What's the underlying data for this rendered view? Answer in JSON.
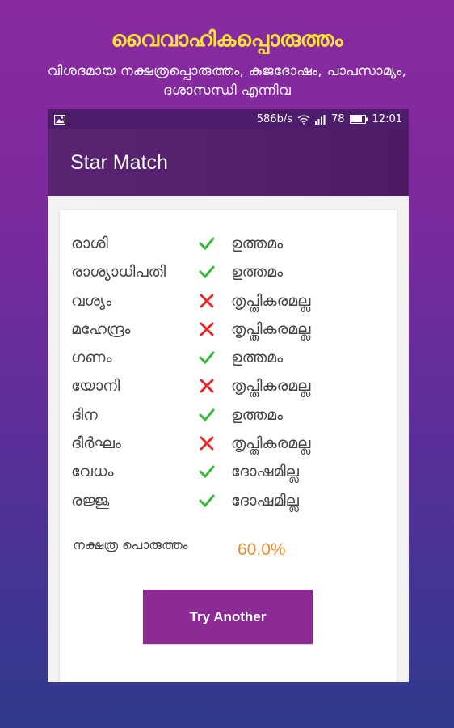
{
  "promo": {
    "title": "വൈവാഹികപ്പൊരുത്തം",
    "subtitle": "വിശദമായ നക്ഷത്രപ്പൊരുത്തം, കുജദോഷം, പാപസാമ്യം, ദശാസന്ധി എന്നിവ"
  },
  "status_bar": {
    "speed": "586b/s",
    "battery": "78",
    "time": "12:01"
  },
  "app_bar": {
    "title": "Star Match"
  },
  "rows": [
    {
      "name": "രാശി",
      "status": "check",
      "result": "ഉത്തമം"
    },
    {
      "name": "രാശ്യാധിപതി",
      "status": "check",
      "result": "ഉത്തമം"
    },
    {
      "name": "വശ്യം",
      "status": "cross",
      "result": "തൃപ്തികരമല്ല"
    },
    {
      "name": "മഹേന്ദ്രം",
      "status": "cross",
      "result": "തൃപ്തികരമല്ല"
    },
    {
      "name": "ഗണം",
      "status": "check",
      "result": "ഉത്തമം"
    },
    {
      "name": "യോനി",
      "status": "cross",
      "result": "തൃപ്തികരമല്ല"
    },
    {
      "name": "ദിന",
      "status": "check",
      "result": "ഉത്തമം"
    },
    {
      "name": "ദീർഘം",
      "status": "cross",
      "result": "തൃപ്തികരമല്ല"
    },
    {
      "name": "വേധം",
      "status": "check",
      "result": "ദോഷമില്ല"
    },
    {
      "name": "രജ്ജു",
      "status": "check",
      "result": "ദോഷമില്ല"
    }
  ],
  "summary": {
    "label": "നക്ഷത്ര പൊരുത്തം",
    "value": "60.0%"
  },
  "button": {
    "label": "Try Another"
  },
  "colors": {
    "check": "#3cb83c",
    "cross": "#e8272a"
  }
}
